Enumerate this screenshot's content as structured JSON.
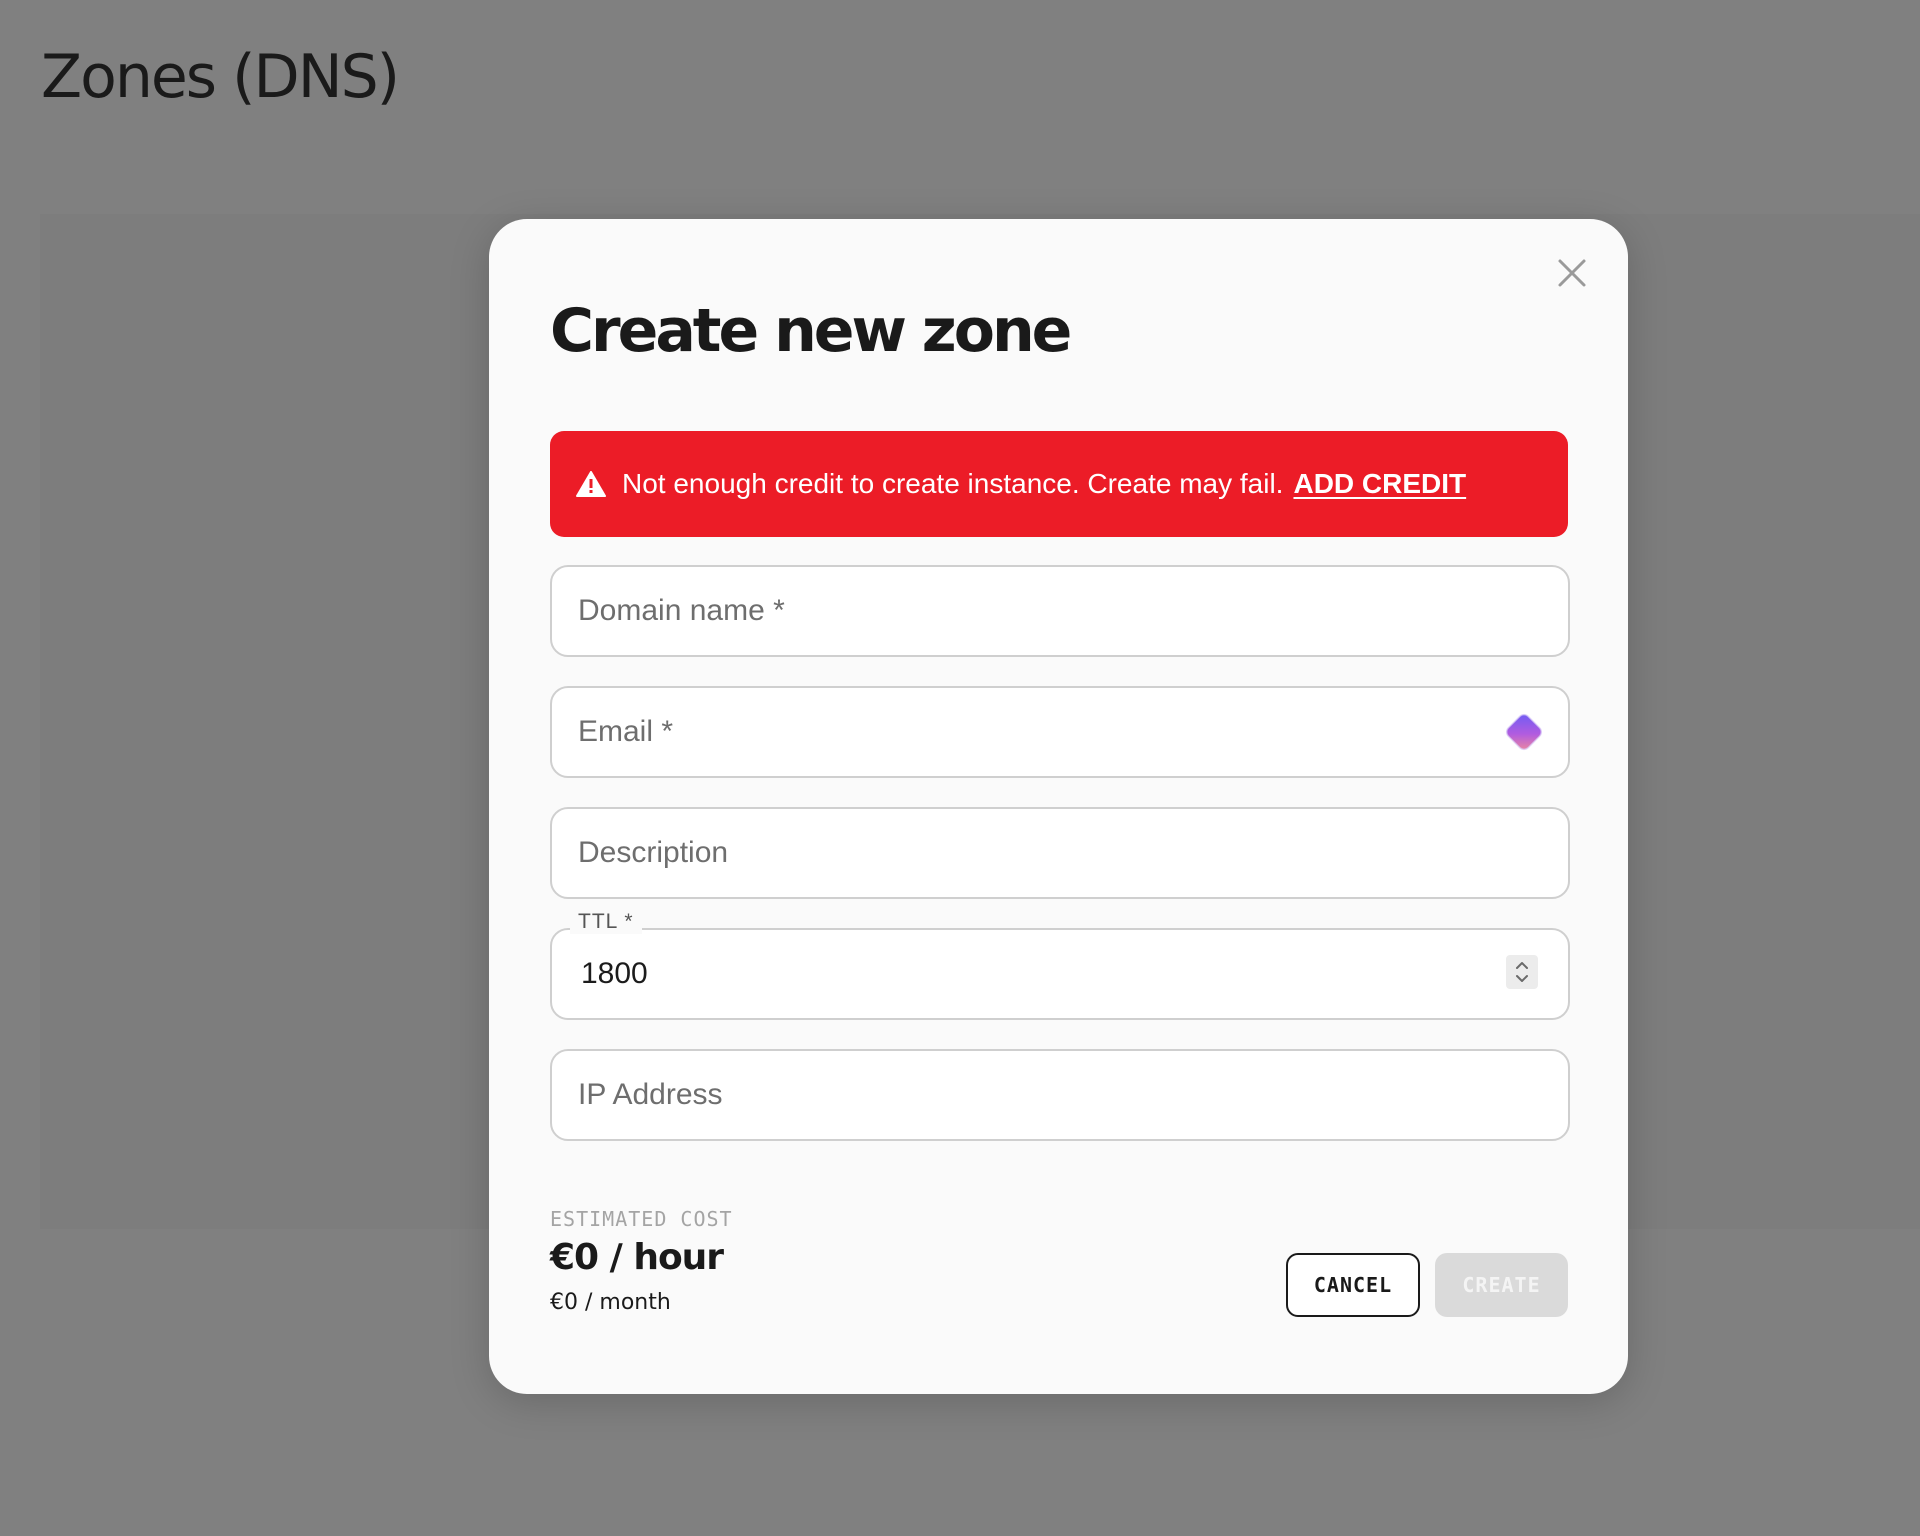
{
  "page": {
    "title": "Zones (DNS)"
  },
  "modal": {
    "title": "Create new zone",
    "close_icon": "close-icon",
    "alert": {
      "icon": "warning-icon",
      "message": "Not enough credit to create instance. Create may fail.",
      "link_label": "ADD CREDIT",
      "color": "#ec1c27"
    },
    "fields": {
      "domain_name": {
        "placeholder": "Domain name *",
        "value": ""
      },
      "email": {
        "placeholder": "Email *",
        "value": "",
        "autofill_icon": "password-manager-icon"
      },
      "description": {
        "placeholder": "Description",
        "value": ""
      },
      "ttl": {
        "label": "TTL *",
        "value": "1800",
        "stepper_icon": "stepper-icon"
      },
      "ip_address": {
        "placeholder": "IP Address",
        "value": ""
      }
    },
    "cost": {
      "label": "ESTIMATED COST",
      "per_hour": "€0 / hour",
      "per_month": "€0 / month"
    },
    "buttons": {
      "cancel_label": "CANCEL",
      "create_label": "CREATE"
    }
  }
}
